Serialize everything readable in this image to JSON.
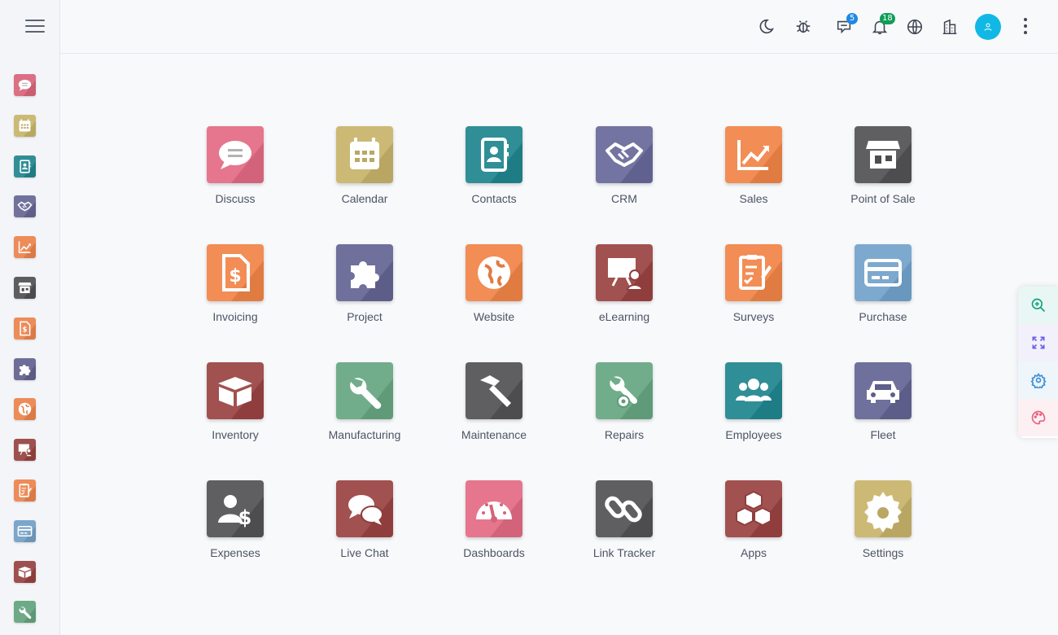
{
  "topbar": {
    "chat_badge": "5",
    "notif_badge": "18"
  },
  "sidebar": {
    "items": [
      {
        "name": "discuss",
        "color": "#c95d72"
      },
      {
        "name": "calendar",
        "color": "#b9a862"
      },
      {
        "name": "contacts",
        "color": "#1e7c85"
      },
      {
        "name": "crm",
        "color": "#5f6089"
      },
      {
        "name": "sales",
        "color": "#db7a47"
      },
      {
        "name": "point-of-sale",
        "color": "#4b4b4d"
      },
      {
        "name": "invoicing",
        "color": "#db7a47"
      },
      {
        "name": "project",
        "color": "#5b5b85"
      },
      {
        "name": "website",
        "color": "#db7a47"
      },
      {
        "name": "elearning",
        "color": "#8c3e3c"
      },
      {
        "name": "surveys",
        "color": "#db7a47"
      },
      {
        "name": "purchase",
        "color": "#6a94b8"
      },
      {
        "name": "inventory",
        "color": "#8c3e3c"
      },
      {
        "name": "manufacturing",
        "color": "#5c9876"
      }
    ]
  },
  "apps": [
    {
      "label": "Discuss",
      "icon": "chat-bubble-icon",
      "color": "#d3647b"
    },
    {
      "label": "Calendar",
      "icon": "calendar-icon",
      "color": "#bba764"
    },
    {
      "label": "Contacts",
      "icon": "address-book-icon",
      "color": "#1e7c85"
    },
    {
      "label": "CRM",
      "icon": "handshake-icon",
      "color": "#626290"
    },
    {
      "label": "Sales",
      "icon": "trend-chart-icon",
      "color": "#e07b43"
    },
    {
      "label": "Point of Sale",
      "icon": "store-icon",
      "color": "#4d4d4f"
    },
    {
      "label": "Invoicing",
      "icon": "invoice-icon",
      "color": "#e07b43"
    },
    {
      "label": "Project",
      "icon": "puzzle-icon",
      "color": "#5e5e8a"
    },
    {
      "label": "Website",
      "icon": "globe-icon",
      "color": "#e07b43"
    },
    {
      "label": "eLearning",
      "icon": "presentation-icon",
      "color": "#8f3f3d"
    },
    {
      "label": "Surveys",
      "icon": "clipboard-check-icon",
      "color": "#e07b43"
    },
    {
      "label": "Purchase",
      "icon": "credit-card-icon",
      "color": "#6b97bd"
    },
    {
      "label": "Inventory",
      "icon": "box-icon",
      "color": "#8f3f3d"
    },
    {
      "label": "Manufacturing",
      "icon": "wrench-icon",
      "color": "#5f9b79"
    },
    {
      "label": "Maintenance",
      "icon": "hammer-icon",
      "color": "#4d4d4f"
    },
    {
      "label": "Repairs",
      "icon": "wrench-gear-icon",
      "color": "#5f9b79"
    },
    {
      "label": "Employees",
      "icon": "users-icon",
      "color": "#1e7c85"
    },
    {
      "label": "Fleet",
      "icon": "car-icon",
      "color": "#5e5e8a"
    },
    {
      "label": "Expenses",
      "icon": "user-dollar-icon",
      "color": "#4d4d4f"
    },
    {
      "label": "Live Chat",
      "icon": "chat-bubbles-icon",
      "color": "#8f3f3d"
    },
    {
      "label": "Dashboards",
      "icon": "gauge-icon",
      "color": "#d3647b"
    },
    {
      "label": "Link Tracker",
      "icon": "link-icon",
      "color": "#4d4d4f"
    },
    {
      "label": "Apps",
      "icon": "cubes-icon",
      "color": "#8f3f3d"
    },
    {
      "label": "Settings",
      "icon": "gear-icon",
      "color": "#bba764"
    }
  ]
}
